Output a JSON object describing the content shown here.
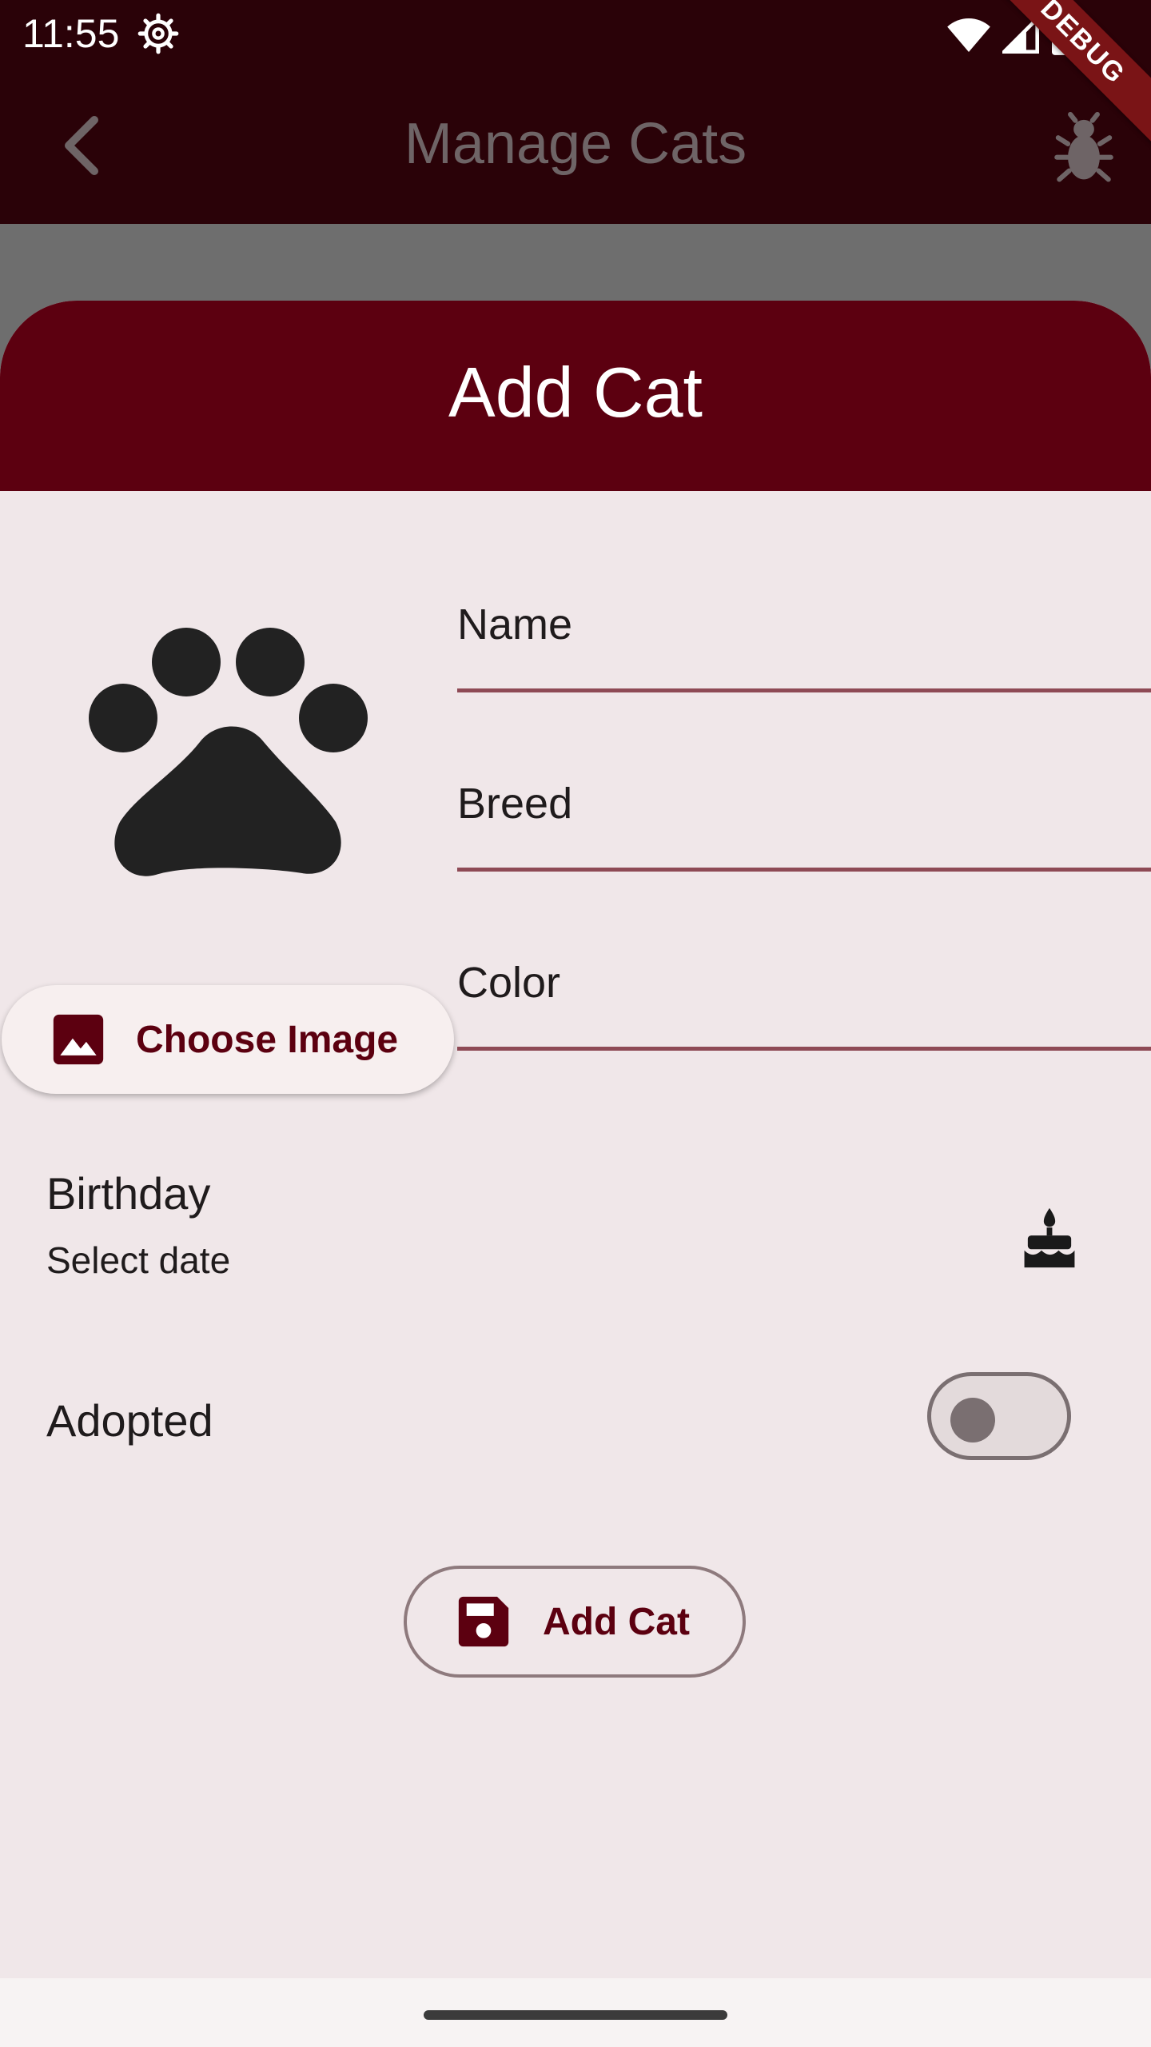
{
  "status_bar": {
    "time": "11:55",
    "debug_banner": "DEBUG"
  },
  "app_bar": {
    "title": "Manage Cats"
  },
  "sheet": {
    "title": "Add Cat",
    "choose_image_label": "Choose Image",
    "fields": {
      "name": {
        "label": "Name",
        "value": ""
      },
      "breed": {
        "label": "Breed",
        "value": ""
      },
      "color": {
        "label": "Color",
        "value": ""
      }
    },
    "birthday": {
      "title": "Birthday",
      "subtitle": "Select date"
    },
    "adopted": {
      "label": "Adopted",
      "on": false
    },
    "submit_label": "Add Cat"
  },
  "icons": {
    "status": [
      "settings-gear-icon",
      "wifi-icon",
      "signal-icon",
      "battery-icon"
    ],
    "app_bar": [
      "back-chevron-icon",
      "bug-icon"
    ],
    "sheet": [
      "paw-icon",
      "image-icon",
      "cake-icon",
      "save-icon"
    ]
  },
  "colors": {
    "app_bar_bg": "#2a0208",
    "sheet_header_bg": "#5c0010",
    "accent": "#5c0010",
    "field_underline": "#8e4a55",
    "sheet_bg": "#f0e7e9"
  }
}
